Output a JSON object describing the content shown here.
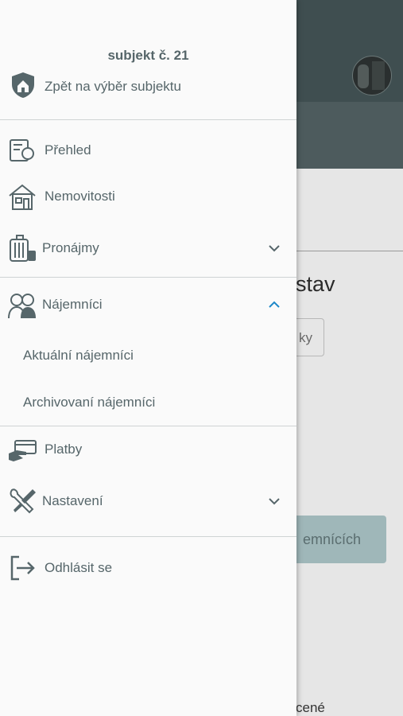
{
  "background": {
    "heading": "stav",
    "button_label": "ky",
    "teal_button_label": "emnících",
    "bottom_text": "cené"
  },
  "drawer": {
    "subject_title": "subjekt č. 21",
    "back_label": "Zpět na výběr subjektu",
    "menu": {
      "overview": "Přehled",
      "properties": "Nemovitosti",
      "rentals": "Pronájmy",
      "tenants": "Nájemníci",
      "tenants_current": "Aktuální nájemníci",
      "tenants_archived": "Archivovaní nájemníci",
      "payments": "Platby",
      "settings": "Nastavení",
      "logout": "Odhlásit se"
    }
  },
  "colors": {
    "text": "#56666a",
    "accent": "#1e88c8",
    "header_bg": "#3f4e50"
  }
}
